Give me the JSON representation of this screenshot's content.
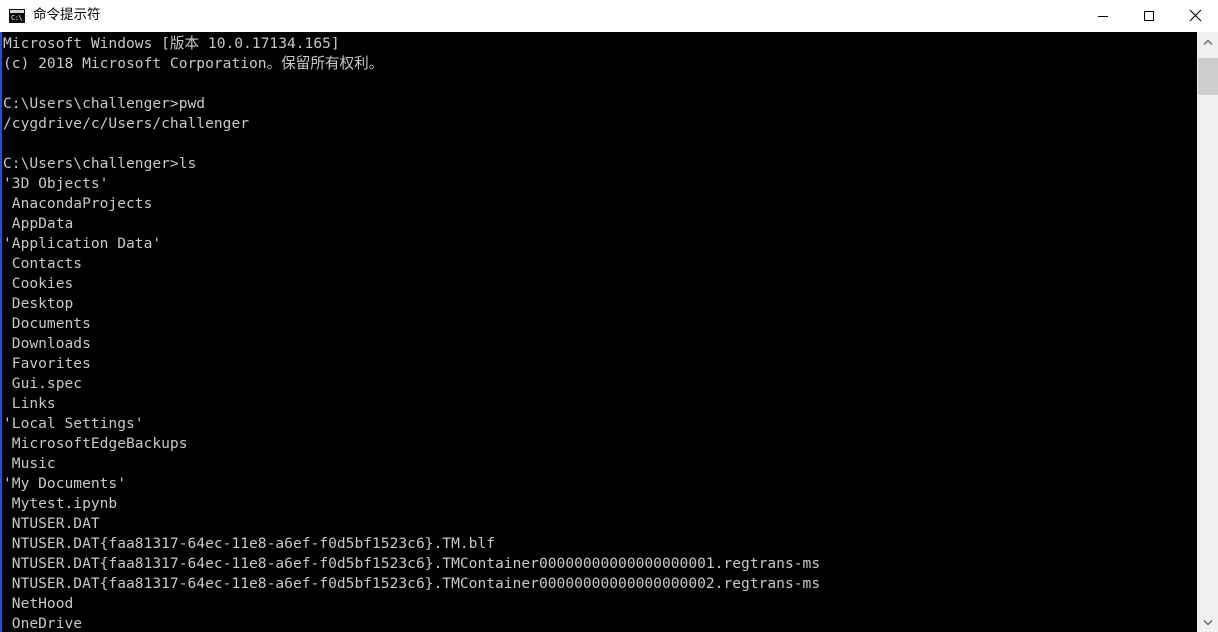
{
  "window": {
    "title": "命令提示符",
    "icon": "cmd-console-icon",
    "icon_glyph": "C:\\",
    "controls": {
      "minimize_label": "最小化",
      "maximize_label": "最大化",
      "close_label": "关闭"
    },
    "titlebar_bg": "#ffffff",
    "title_color": "#000000"
  },
  "console": {
    "background": "#000000",
    "foreground": "#c8c8c8",
    "border_color": "#1f4fd8",
    "lines": [
      "Microsoft Windows [版本 10.0.17134.165]",
      "(c) 2018 Microsoft Corporation。保留所有权利。",
      "",
      "C:\\Users\\challenger>pwd",
      "/cygdrive/c/Users/challenger",
      "",
      "C:\\Users\\challenger>ls",
      "'3D Objects'",
      " AnacondaProjects",
      " AppData",
      "'Application Data'",
      " Contacts",
      " Cookies",
      " Desktop",
      " Documents",
      " Downloads",
      " Favorites",
      " Gui.spec",
      " Links",
      "'Local Settings'",
      " MicrosoftEdgeBackups",
      " Music",
      "'My Documents'",
      " Mytest.ipynb",
      " NTUSER.DAT",
      " NTUSER.DAT{faa81317-64ec-11e8-a6ef-f0d5bf1523c6}.TM.blf",
      " NTUSER.DAT{faa81317-64ec-11e8-a6ef-f0d5bf1523c6}.TMContainer00000000000000000001.regtrans-ms",
      " NTUSER.DAT{faa81317-64ec-11e8-a6ef-f0d5bf1523c6}.TMContainer00000000000000000002.regtrans-ms",
      " NetHood",
      " OneDrive"
    ],
    "commands": [
      {
        "prompt": "C:\\Users\\challenger>",
        "command": "pwd",
        "output": "/cygdrive/c/Users/challenger"
      },
      {
        "prompt": "C:\\Users\\challenger>",
        "command": "ls",
        "output": "directory listing"
      }
    ],
    "header": {
      "os_line": "Microsoft Windows [版本 10.0.17134.165]",
      "copyright_line": "(c) 2018 Microsoft Corporation。保留所有权利。",
      "version": "10.0.17134.165",
      "year": "2018"
    }
  },
  "scrollbar": {
    "up_arrow": "chevron-up-icon",
    "down_arrow": "chevron-down-icon",
    "track_color": "#f0f0f0",
    "thumb_color": "#cdcdcd"
  }
}
